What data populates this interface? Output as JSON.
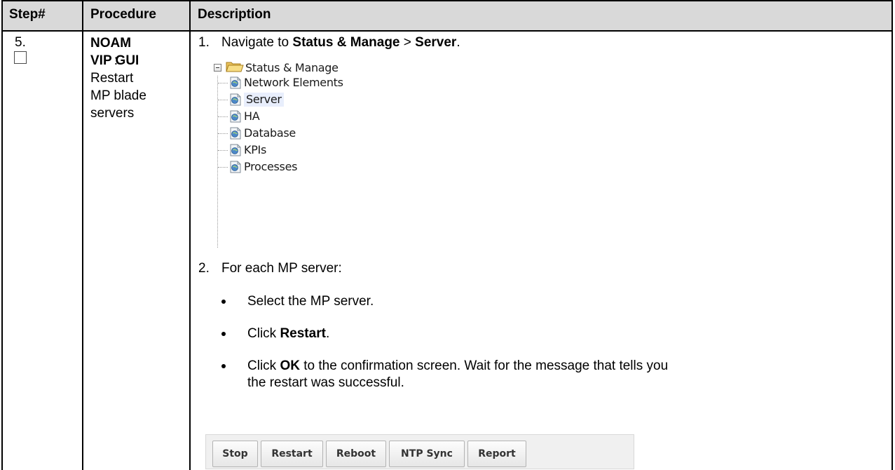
{
  "header": {
    "step": "Step#",
    "procedure": "Procedure",
    "description": "Description"
  },
  "row": {
    "step_number": "5.",
    "procedure_bold": "NOAM VIP GUI",
    "procedure_colon": ":",
    "procedure_text": [
      "Restart",
      "MP blade",
      "servers"
    ],
    "step1": {
      "num": "1.",
      "pre": "Navigate to ",
      "b1": "Status & Manage",
      "mid": " > ",
      "b2": "Server",
      "post": "."
    },
    "tree": {
      "root": "Status & Manage",
      "items": [
        "Network Elements",
        "Server",
        "HA",
        "Database",
        "KPIs",
        "Processes"
      ],
      "selected": "Server"
    },
    "step2": {
      "num": "2.",
      "text": "For each MP server:"
    },
    "bullets": {
      "b1": "Select the MP server.",
      "b2_pre": "Click ",
      "b2_bold": "Restart",
      "b2_post": ".",
      "b3_pre": "Click ",
      "b3_bold": "OK",
      "b3_post": " to the confirmation screen.  Wait for the message that tells you",
      "b3_line2": "the restart was successful."
    },
    "buttons": [
      "Stop",
      "Restart",
      "Reboot",
      "NTP Sync",
      "Report"
    ]
  },
  "colors": {
    "header_bg": "#d9d9d9",
    "selection_highlight": "#e8eefc",
    "button_bar_bg": "#f0f0f0"
  }
}
